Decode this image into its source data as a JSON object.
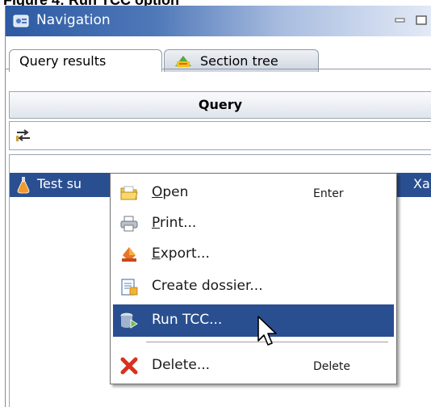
{
  "caption": "Figure 4: Run TCC option",
  "window": {
    "title": "Navigation",
    "title_icon": "navigation-icon",
    "controls": [
      "minimize-icon",
      "maximize-icon"
    ]
  },
  "tabs": [
    {
      "label": "Query results",
      "active": true
    },
    {
      "label": "Section tree",
      "active": false,
      "icon": "section-tree-icon"
    }
  ],
  "column_header": "Query",
  "filter_icon": "filter-icon",
  "list": {
    "selected_row_text": "Test su",
    "selected_row_text_right": "Xan",
    "row_icon": "flask-icon"
  },
  "context_menu": {
    "items": [
      {
        "label": "Open",
        "mnemonic": "O",
        "rest": "pen",
        "accelerator": "Enter",
        "icon": "open-folder-icon"
      },
      {
        "label": "Print...",
        "mnemonic": "P",
        "rest": "rint...",
        "accelerator": "",
        "icon": "printer-icon"
      },
      {
        "label": "Export...",
        "mnemonic": "E",
        "rest": "xport...",
        "accelerator": "",
        "icon": "export-icon"
      },
      {
        "label": "Create dossier...",
        "accelerator": "",
        "icon": "create-dossier-icon"
      },
      {
        "label": "Run TCC...",
        "accelerator": "",
        "icon": "run-tcc-icon",
        "highlighted": true
      },
      {
        "label": "Delete...",
        "accelerator": "Delete",
        "icon": "delete-x-icon"
      }
    ]
  },
  "colors": {
    "selection": "#2a4f91",
    "titlebar_start": "#2c5aa3",
    "titlebar_end": "#e3eaf6"
  }
}
